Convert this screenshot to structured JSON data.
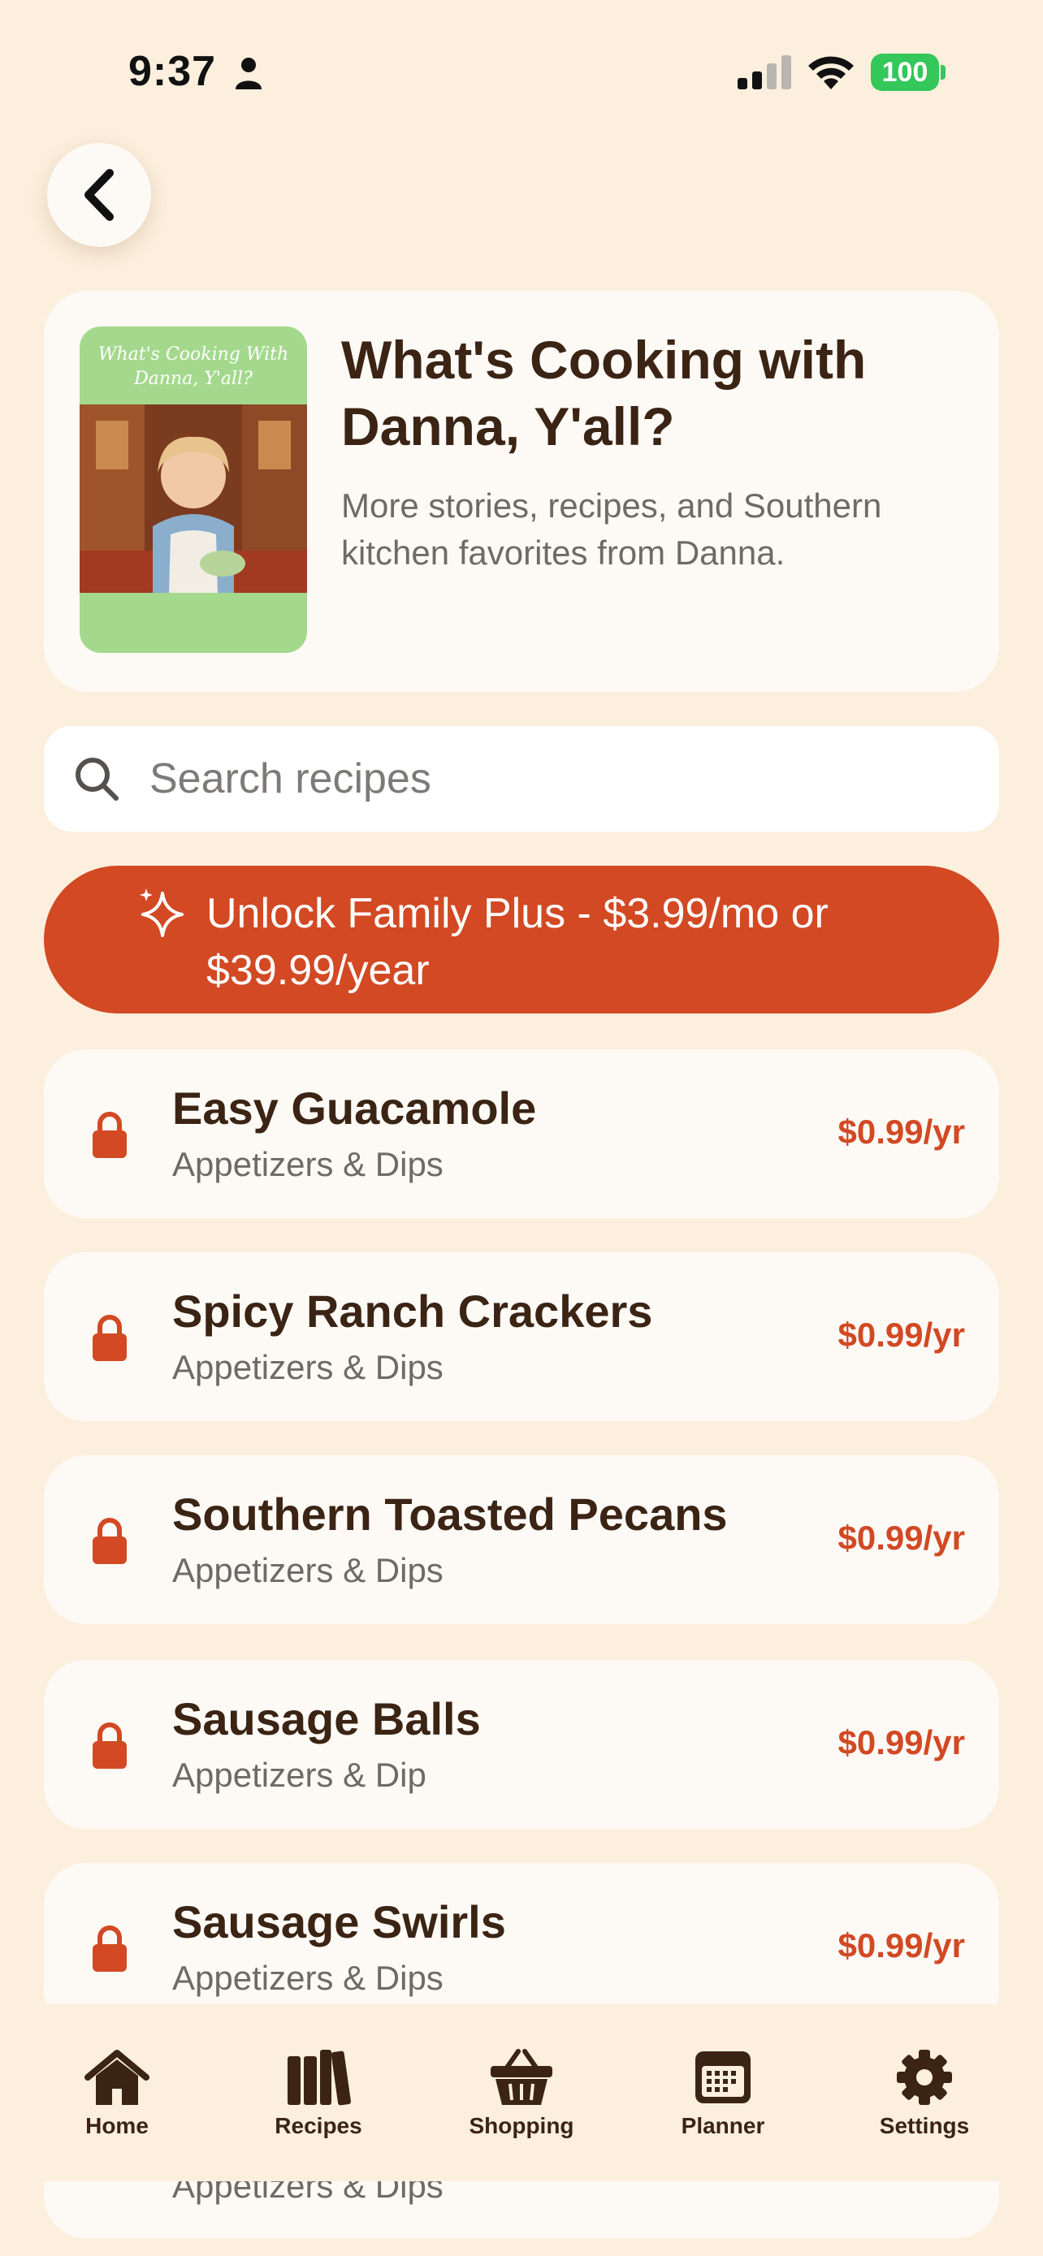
{
  "status_bar": {
    "time": "9:37",
    "battery": "100"
  },
  "header": {
    "title": "What's Cooking with Danna, Y'all?",
    "subtitle": "More stories, recipes, and Southern kitchen favorites from Danna.",
    "cover_title": "What's Cooking With Danna, Y'all?"
  },
  "search": {
    "placeholder": "Search recipes",
    "value": ""
  },
  "unlock": {
    "label": "Unlock Family Plus - $3.99/mo or $39.99/year"
  },
  "recipes": [
    {
      "name": "Easy Guacamole",
      "category": "Appetizers & Dips",
      "price": "$0.99/yr"
    },
    {
      "name": "Spicy Ranch Crackers",
      "category": "Appetizers & Dips",
      "price": "$0.99/yr"
    },
    {
      "name": "Southern Toasted Pecans",
      "category": "Appetizers & Dips",
      "price": "$0.99/yr"
    },
    {
      "name": "Sausage Balls",
      "category": "Appetizers & Dip",
      "price": "$0.99/yr"
    },
    {
      "name": "Sausage Swirls",
      "category": "Appetizers & Dips",
      "price": "$0.99/yr"
    },
    {
      "name": "",
      "category": "Appetizers & Dips",
      "price": ""
    }
  ],
  "tabs": [
    {
      "label": "Home",
      "icon": "home-icon"
    },
    {
      "label": "Recipes",
      "icon": "books-icon"
    },
    {
      "label": "Shopping",
      "icon": "basket-icon"
    },
    {
      "label": "Planner",
      "icon": "calendar-icon"
    },
    {
      "label": "Settings",
      "icon": "gear-icon"
    }
  ],
  "colors": {
    "background": "#fcefdd",
    "accent": "#d24923",
    "text": "#3b2414",
    "card": "#fdfaf6",
    "cover": "#a4d98d"
  }
}
